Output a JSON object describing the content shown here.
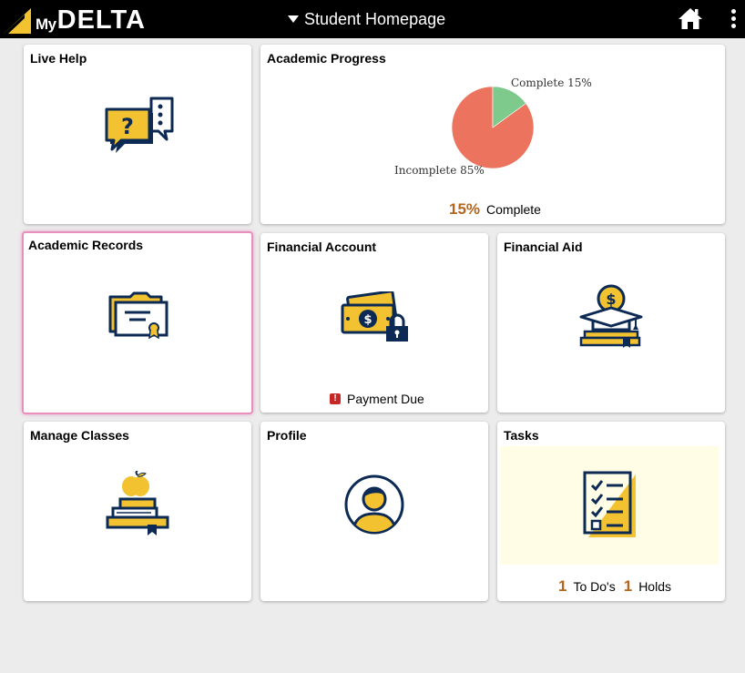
{
  "header": {
    "logo_my": "My",
    "logo_delta": "DELTA",
    "title": "Student Homepage"
  },
  "colors": {
    "navy": "#0c2a54",
    "gold": "#f2c230",
    "pie_incomplete": "#ec735d",
    "pie_complete": "#7dca8c",
    "accent_number": "#b5651d",
    "alert_red": "#c62828",
    "selected_border": "#e78fbd"
  },
  "tiles": {
    "live_help": {
      "title": "Live Help",
      "icon": "chat-help-icon"
    },
    "academic_progress": {
      "title": "Academic Progress",
      "complete_pct_text": "15%",
      "complete_label": "Complete",
      "pie_complete_label": "Complete 15%",
      "pie_incomplete_label": "Incomplete 85%"
    },
    "academic_records": {
      "title": "Academic Records",
      "icon": "certificate-folder-icon"
    },
    "financial_account": {
      "title": "Financial Account",
      "icon": "money-lock-icon",
      "status": "Payment Due"
    },
    "financial_aid": {
      "title": "Financial Aid",
      "icon": "grad-cap-money-icon"
    },
    "manage_classes": {
      "title": "Manage Classes",
      "icon": "books-apple-icon"
    },
    "profile": {
      "title": "Profile",
      "icon": "user-avatar-icon"
    },
    "tasks": {
      "title": "Tasks",
      "icon": "checklist-icon",
      "todo_count": "1",
      "todo_label": "To Do's",
      "holds_count": "1",
      "holds_label": "Holds"
    }
  },
  "chart_data": {
    "type": "pie",
    "categories": [
      "Complete",
      "Incomplete"
    ],
    "values": [
      15,
      85
    ],
    "labels": [
      "Complete 15%",
      "Incomplete 85%"
    ]
  }
}
